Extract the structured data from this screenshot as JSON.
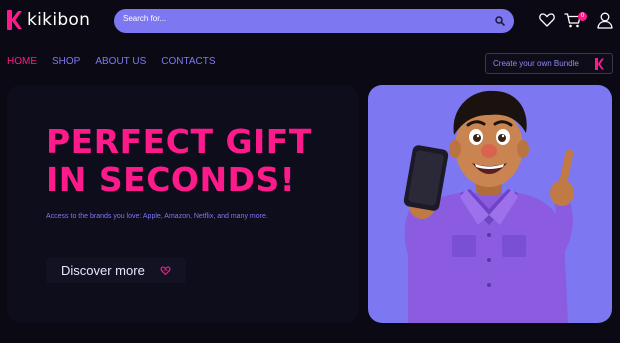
{
  "brand": {
    "name": "kikibon",
    "color": "#ff1a8c"
  },
  "search": {
    "placeholder": "Search for..."
  },
  "header_icons": [
    "heart-icon",
    "cart-icon",
    "user-icon"
  ],
  "cart": {
    "count": "0"
  },
  "nav": {
    "items": [
      {
        "label": "HOME",
        "active": true
      },
      {
        "label": "SHOP",
        "active": false
      },
      {
        "label": "ABOUT US",
        "active": false
      },
      {
        "label": "CONTACTS",
        "active": false
      }
    ],
    "bundle_label": "Create your own Bundle"
  },
  "hero": {
    "title_line1": "PERFECT GIFT",
    "title_line2": "IN SECONDS!",
    "subtitle": "Access to the brands you love: Apple, Amazon, Netflix, and many more.",
    "cta_label": "Discover more"
  },
  "colors": {
    "accent": "#ff1a8c",
    "secondary": "#7d78f2",
    "background": "#0b0a14",
    "card": "#0e0d1c"
  }
}
